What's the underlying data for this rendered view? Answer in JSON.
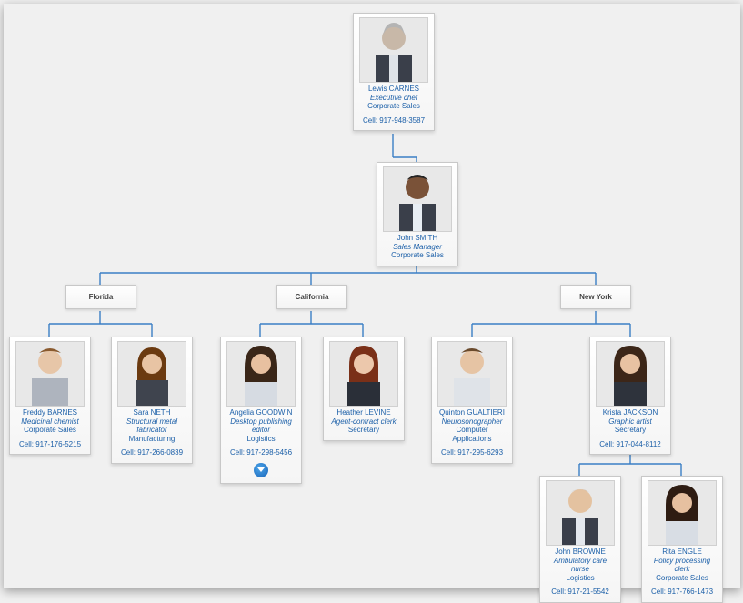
{
  "chart_data": {
    "type": "tree",
    "root": {
      "name": "Lewis CARNES",
      "role": "Executive chef",
      "dept": "Corporate Sales",
      "cell": "Cell: 917-948-3587",
      "children": [
        {
          "name": "John SMITH",
          "role": "Sales Manager",
          "dept": "Corporate Sales",
          "cell": "",
          "children": [
            {
              "region": "Florida",
              "children": [
                {
                  "name": "Freddy BARNES",
                  "role": "Medicinal chemist",
                  "dept": "Corporate Sales",
                  "cell": "Cell: 917-176-5215"
                },
                {
                  "name": "Sara NETH",
                  "role": "Structural metal fabricator",
                  "dept": "Manufacturing",
                  "cell": "Cell: 917-266-0839"
                }
              ]
            },
            {
              "region": "California",
              "children": [
                {
                  "name": "Angelia GOODWIN",
                  "role": "Desktop publishing editor",
                  "dept": "Logistics",
                  "cell": "Cell: 917-298-5456",
                  "expandable": true
                },
                {
                  "name": "Heather LEVINE",
                  "role": "Agent-contract clerk",
                  "dept": "Secretary",
                  "cell": ""
                }
              ]
            },
            {
              "region": "New York",
              "children": [
                {
                  "name": "Quinton GUALTIERI",
                  "role": "Neurosonographer",
                  "dept": "Computer Applications",
                  "cell": "Cell: 917-295-6293"
                },
                {
                  "name": "Krista JACKSON",
                  "role": "Graphic artist",
                  "dept": "Secretary",
                  "cell": "Cell: 917-044-8112",
                  "children": [
                    {
                      "name": "John BROWNE",
                      "role": "Ambulatory care nurse",
                      "dept": "Logistics",
                      "cell": "Cell: 917-21-5542"
                    },
                    {
                      "name": "Rita ENGLE",
                      "role": "Policy processing clerk",
                      "dept": "Corporate Sales",
                      "cell": "Cell: 917-766-1473"
                    }
                  ]
                }
              ]
            }
          ]
        }
      ]
    }
  },
  "people": {
    "lewis": {
      "name": "Lewis CARNES",
      "role": "Executive chef",
      "dept": "Corporate Sales",
      "cell": "Cell: 917-948-3587"
    },
    "john_s": {
      "name": "John SMITH",
      "role": "Sales Manager",
      "dept": "Corporate Sales",
      "cell": ""
    },
    "freddy": {
      "name": "Freddy BARNES",
      "role": "Medicinal chemist",
      "dept": "Corporate Sales",
      "cell": "Cell: 917-176-5215"
    },
    "sara": {
      "name": "Sara NETH",
      "role": "Structural metal fabricator",
      "dept": "Manufacturing",
      "cell": "Cell: 917-266-0839"
    },
    "angelia": {
      "name": "Angelia GOODWIN",
      "role": "Desktop publishing editor",
      "dept": "Logistics",
      "cell": "Cell: 917-298-5456"
    },
    "heather": {
      "name": "Heather LEVINE",
      "role": "Agent-contract clerk",
      "dept": "Secretary",
      "cell": ""
    },
    "quinton": {
      "name": "Quinton GUALTIERI",
      "role": "Neurosonographer",
      "dept": "Computer Applications",
      "cell": "Cell: 917-295-6293"
    },
    "krista": {
      "name": "Krista JACKSON",
      "role": "Graphic artist",
      "dept": "Secretary",
      "cell": "Cell: 917-044-8112"
    },
    "john_b": {
      "name": "John BROWNE",
      "role": "Ambulatory care nurse",
      "dept": "Logistics",
      "cell": "Cell: 917-21-5542"
    },
    "rita": {
      "name": "Rita ENGLE",
      "role": "Policy processing clerk",
      "dept": "Corporate Sales",
      "cell": "Cell: 917-766-1473"
    }
  },
  "regions": {
    "fl": "Florida",
    "ca": "California",
    "ny": "New York"
  }
}
